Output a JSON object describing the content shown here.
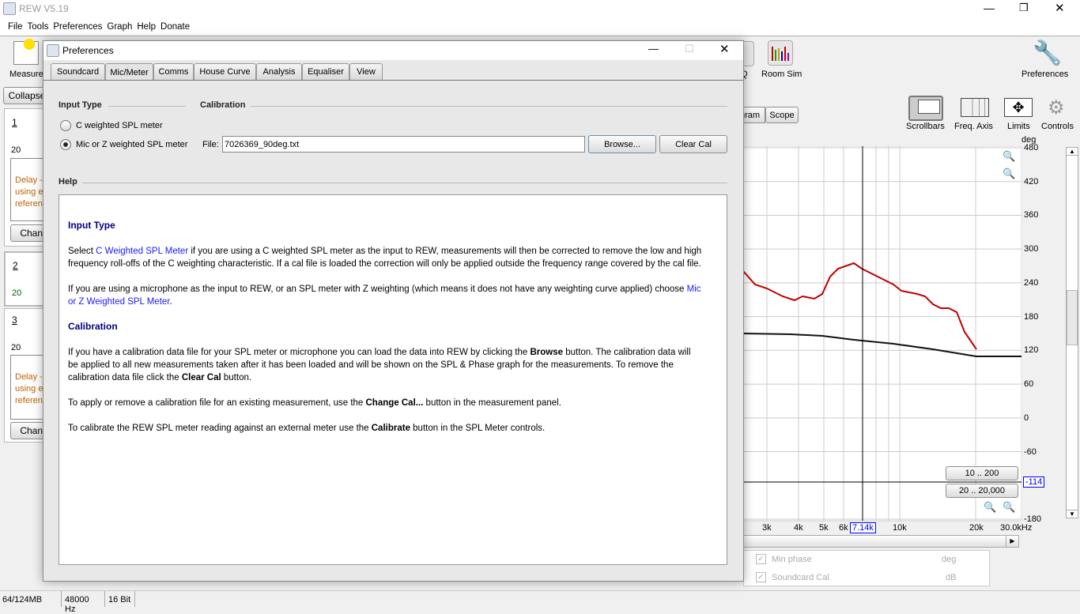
{
  "app": {
    "title": "REW V5.19",
    "menu": [
      "File",
      "Tools",
      "Preferences",
      "Graph",
      "Help",
      "Donate"
    ]
  },
  "toolbar": {
    "measure": "Measure",
    "eq_partial": "Q",
    "room_sim": "Room Sim",
    "preferences": "Preferences",
    "tab_partial": "gram",
    "scope": "Scope",
    "scrollbars": "Scrollbars",
    "freq_axis": "Freq. Axis",
    "limits": "Limits",
    "controls": "Controls"
  },
  "left_panel": {
    "collapse": "Collapse",
    "measurements": [
      {
        "num": "1",
        "axis": "20",
        "text": [
          "Delay -",
          "using e",
          "referen"
        ],
        "button": "Chang"
      },
      {
        "num": "2",
        "axis": "20"
      },
      {
        "num": "3",
        "axis": "20",
        "text": [
          "Delay -",
          "using e",
          "referen"
        ],
        "button": "Chang"
      }
    ]
  },
  "graph": {
    "unit": "deg",
    "y_ticks": [
      "480",
      "420",
      "360",
      "300",
      "240",
      "180",
      "120",
      "60",
      "0",
      "-60",
      "-114",
      "-180"
    ],
    "x_ticks": [
      "3k",
      "4k",
      "5k",
      "6k",
      "10k",
      "20k",
      "30.0kHz"
    ],
    "cursor_x": "7.14k",
    "cursor_y": "-114",
    "range_buttons": [
      "10 .. 200",
      "20 .. 20,000"
    ],
    "colors": {
      "trace1": "#c00000",
      "trace2": "#111111",
      "cursor": "#0000ff"
    }
  },
  "legend": [
    {
      "label": "Min phase",
      "unit": "deg"
    },
    {
      "label": "Soundcard Cal",
      "unit": "dB"
    }
  ],
  "status": {
    "memory": "64/124MB",
    "rate": "48000 Hz",
    "bits": "16 Bit"
  },
  "dialog": {
    "title": "Preferences",
    "tabs": [
      "Soundcard",
      "Mic/Meter",
      "Comms",
      "House Curve",
      "Analysis",
      "Equaliser",
      "View"
    ],
    "active_tab": "Mic/Meter",
    "input_type": {
      "heading": "Input Type",
      "options": [
        "C weighted SPL meter",
        "Mic or Z weighted SPL meter"
      ],
      "selected": 1
    },
    "calibration": {
      "heading": "Calibration",
      "file_label": "File:",
      "file_value": "7026369_90deg.txt",
      "browse": "Browse...",
      "clear": "Clear Cal"
    },
    "help": {
      "heading": "Help",
      "title1": "Input Type",
      "p1a": "Select ",
      "p1link": "C Weighted SPL Meter",
      "p1b": " if you are using a C weighted SPL meter as the input to REW, measurements will then be corrected to remove the low and high frequency roll-offs of the C weighting characteristic. If a cal file is loaded the correction will only be applied outside the frequency range covered by the cal file.",
      "p2a": "If you are using a microphone as the input to REW, or an SPL meter with Z weighting (which means it does not have any weighting curve applied) choose ",
      "p2link": "Mic or Z Weighted SPL Meter",
      "p2b": ".",
      "title2": "Calibration",
      "p3a": "If you have a calibration data file for your SPL meter or microphone you can load the data into REW by clicking the ",
      "p3b1": "Browse",
      "p3b": " button. The calibration data will be applied to all new measurements taken after it has been loaded and will be shown on the SPL & Phase graph for the measurements. To remove the calibration data file click the ",
      "p3b2": "Clear Cal",
      "p3c": " button.",
      "p4a": "To apply or remove a calibration file for an existing measurement, use the ",
      "p4b": "Change Cal...",
      "p4c": " button in the measurement panel.",
      "p5a": "To calibrate the REW SPL meter reading against an external meter use the ",
      "p5b": "Calibrate",
      "p5c": " button in the SPL Meter controls."
    }
  }
}
